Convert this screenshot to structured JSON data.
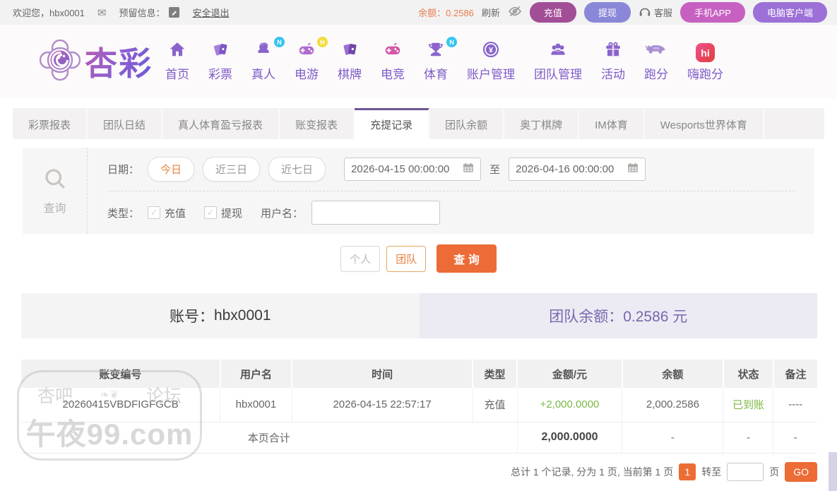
{
  "topbar": {
    "welcome": "欢迎您，hbx0001",
    "reserved_info_label": "预留信息：",
    "logout": "安全退出",
    "balance_label": "余额：",
    "balance_value": "0.2586",
    "refresh": "刷新",
    "deposit_btn": "充值",
    "withdraw_btn": "提现",
    "service": "客服",
    "mobile_app_btn": "手机APP",
    "pc_client_btn": "电脑客户端"
  },
  "header": {
    "brand": "杏彩",
    "nav": [
      {
        "label": "首页",
        "badge": ""
      },
      {
        "label": "彩票",
        "badge": ""
      },
      {
        "label": "真人",
        "badge": "N"
      },
      {
        "label": "电游",
        "badge": "H"
      },
      {
        "label": "棋牌",
        "badge": ""
      },
      {
        "label": "电竞",
        "badge": ""
      },
      {
        "label": "体育",
        "badge": "N"
      },
      {
        "label": "账户管理",
        "badge": ""
      },
      {
        "label": "团队管理",
        "badge": ""
      },
      {
        "label": "活动",
        "badge": ""
      },
      {
        "label": "跑分",
        "badge": ""
      },
      {
        "label": "嗨跑分",
        "badge": ""
      }
    ]
  },
  "tabs": [
    "彩票报表",
    "团队日结",
    "真人体育盈亏报表",
    "账变报表",
    "充提记录",
    "团队余额",
    "奥丁棋牌",
    "IM体育",
    "Wesports世界体育"
  ],
  "filter": {
    "search_label": "查询",
    "date_label": "日期：",
    "quick_ranges": [
      "今日",
      "近三日",
      "近七日"
    ],
    "date_from": "2026-04-15 00:00:00",
    "to_label": "至",
    "date_to": "2026-04-16 00:00:00",
    "type_label": "类型：",
    "type_deposit": "充值",
    "type_withdraw": "提现",
    "username_label": "用户名：",
    "username_value": ""
  },
  "actions": {
    "personal": "个人",
    "team": "团队",
    "search": "查 询"
  },
  "account_bar": {
    "account_label": "账号：",
    "account_value": "hbx0001",
    "team_balance_label": "团队余额：",
    "team_balance_value": "0.2586 元"
  },
  "table": {
    "headers": [
      "账变编号",
      "用户名",
      "时间",
      "类型",
      "金额/元",
      "余额",
      "状态",
      "备注"
    ],
    "rows": [
      [
        "20260415VBDFIGFGCB",
        "hbx0001",
        "2026-04-15 22:57:17",
        "充值",
        "+2,000.0000",
        "2,000.2586",
        "已到账",
        "----"
      ]
    ],
    "summary": {
      "label": "本页合计",
      "amount": "2,000.0000",
      "dash": "-"
    }
  },
  "pagination": {
    "summary": "总计 1 个记录, 分为 1 页, 当前第 1 页",
    "current": "1",
    "goto_label": "转至",
    "page_label": "页",
    "go": "GO"
  },
  "watermark": {
    "left": "杏吧",
    "right": "论坛",
    "site": "午夜99.com"
  },
  "colors": {
    "accent_orange": "#ed6c35",
    "orange_text": "#e8823f",
    "balance_orange": "#e87e50",
    "nav_purple": "#7e5bc8",
    "active_tab_border": "#6c5595",
    "team_balance_purple": "#7a68ad",
    "success_green": "#7cb845",
    "deposit_pill": "#a24e97",
    "withdraw_pill": "#8b87d8",
    "mobile_pill": "#c761c1",
    "pc_pill": "#9c70d6"
  }
}
